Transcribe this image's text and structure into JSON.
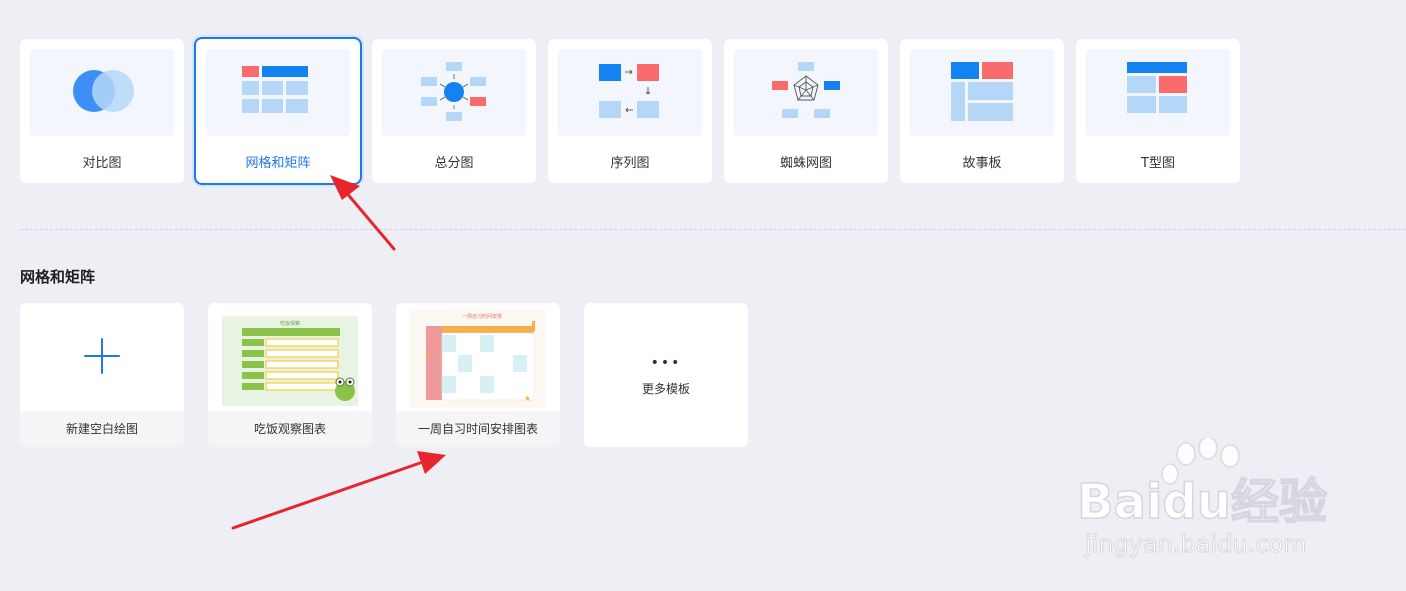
{
  "categories": [
    {
      "label": "对比图"
    },
    {
      "label": "网格和矩阵"
    },
    {
      "label": "总分图"
    },
    {
      "label": "序列图"
    },
    {
      "label": "蜘蛛网图"
    },
    {
      "label": "故事板"
    },
    {
      "label": "T型图"
    }
  ],
  "selected_category": "网格和矩阵",
  "section": {
    "title": "网格和矩阵"
  },
  "templates": [
    {
      "label": "新建空白绘图"
    },
    {
      "label": "吃饭观察图表",
      "thumb_title": "吃饭观察"
    },
    {
      "label": "一周自习时间安排图表",
      "thumb_title": "一周自习时间安排"
    }
  ],
  "more": {
    "dots": "•••",
    "label": "更多模板"
  },
  "watermark": {
    "brand": "Baidu经验",
    "url": "jingyan.baidu.com"
  },
  "colors": {
    "accent": "#1e78e6",
    "blue": "#1482f0",
    "light_blue": "#b5d7f7",
    "red": "#fa6b6b",
    "arrow": "#e8242c"
  }
}
